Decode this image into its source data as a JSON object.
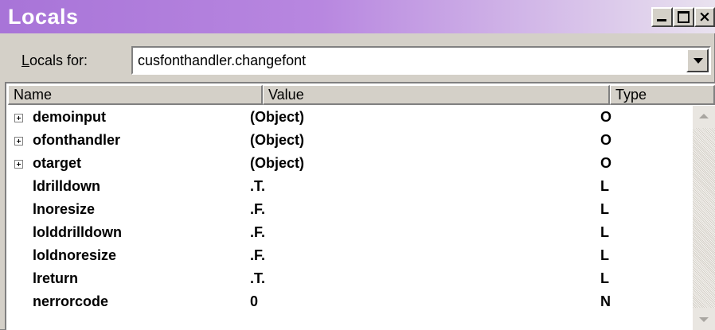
{
  "window": {
    "title": "Locals",
    "buttons": {
      "minimize": "minimize",
      "maximize": "maximize",
      "close": "×"
    }
  },
  "locals_for": {
    "label_prefix": "L",
    "label_rest": "ocals for:",
    "selected": "cusfonthandler.changefont"
  },
  "columns": {
    "name": "Name",
    "value": "Value",
    "type": "Type"
  },
  "rows": [
    {
      "expandable": true,
      "name": "demoinput",
      "value": "(Object)",
      "type": "O"
    },
    {
      "expandable": true,
      "name": "ofonthandler",
      "value": "(Object)",
      "type": "O"
    },
    {
      "expandable": true,
      "name": "otarget",
      "value": "(Object)",
      "type": "O"
    },
    {
      "expandable": false,
      "name": "ldrilldown",
      "value": ".T.",
      "type": "L"
    },
    {
      "expandable": false,
      "name": "lnoresize",
      "value": ".F.",
      "type": "L"
    },
    {
      "expandable": false,
      "name": "lolddrilldown",
      "value": ".F.",
      "type": "L"
    },
    {
      "expandable": false,
      "name": "loldnoresize",
      "value": ".F.",
      "type": "L"
    },
    {
      "expandable": false,
      "name": "lreturn",
      "value": ".T.",
      "type": "L"
    },
    {
      "expandable": false,
      "name": "nerrorcode",
      "value": "0",
      "type": "N"
    }
  ],
  "colors": {
    "titlebar_start": "#a874d8",
    "titlebar_end": "#e9e2ef",
    "chrome": "#d4d0c8"
  }
}
